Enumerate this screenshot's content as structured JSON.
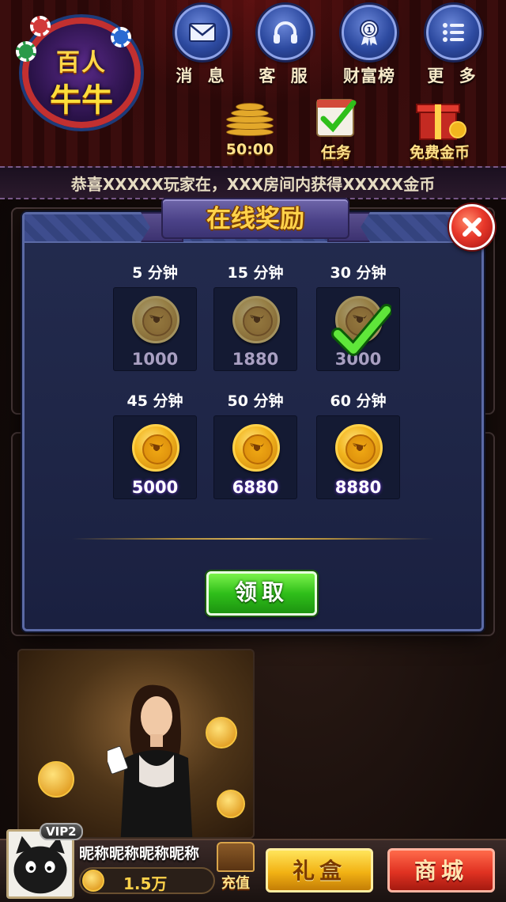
{
  "logo": {
    "line1": "百人",
    "line2": "牛牛"
  },
  "top_nav": [
    {
      "label": "消 息",
      "icon": "envelope-icon"
    },
    {
      "label": "客 服",
      "icon": "headset-icon"
    },
    {
      "label": "财富榜",
      "icon": "medal-icon"
    },
    {
      "label": "更 多",
      "icon": "list-icon"
    }
  ],
  "quick_actions": {
    "timer": "50:00",
    "tasks": "任务",
    "free_coins": "免费金币"
  },
  "marquee": {
    "text": "恭喜XXXXX玩家在，XXX房间内获得XXXXX金币"
  },
  "dialog": {
    "title": "在线奖励",
    "claim_label": "领取",
    "rewards": [
      {
        "time": "5 分钟",
        "amount": "1000",
        "state": "locked"
      },
      {
        "time": "15 分钟",
        "amount": "1880",
        "state": "locked"
      },
      {
        "time": "30 分钟",
        "amount": "3000",
        "state": "claimed"
      },
      {
        "time": "45 分钟",
        "amount": "5000",
        "state": "available"
      },
      {
        "time": "50 分钟",
        "amount": "6880",
        "state": "available"
      },
      {
        "time": "60 分钟",
        "amount": "8880",
        "state": "available"
      }
    ]
  },
  "player": {
    "vip": "VIP2",
    "nickname": "昵称昵称昵称昵称",
    "gold": "1.5万",
    "recharge_label": "充值"
  },
  "bottom_buttons": {
    "gift_box": "礼盒",
    "shop": "商城"
  },
  "colors": {
    "dialog_bg": "#1e2546",
    "title_gold": "#ffd24a",
    "claim_green": "#2fbf1a",
    "close_red": "#e8382a",
    "shop_red": "#e03222",
    "gift_gold": "#f2b214"
  }
}
